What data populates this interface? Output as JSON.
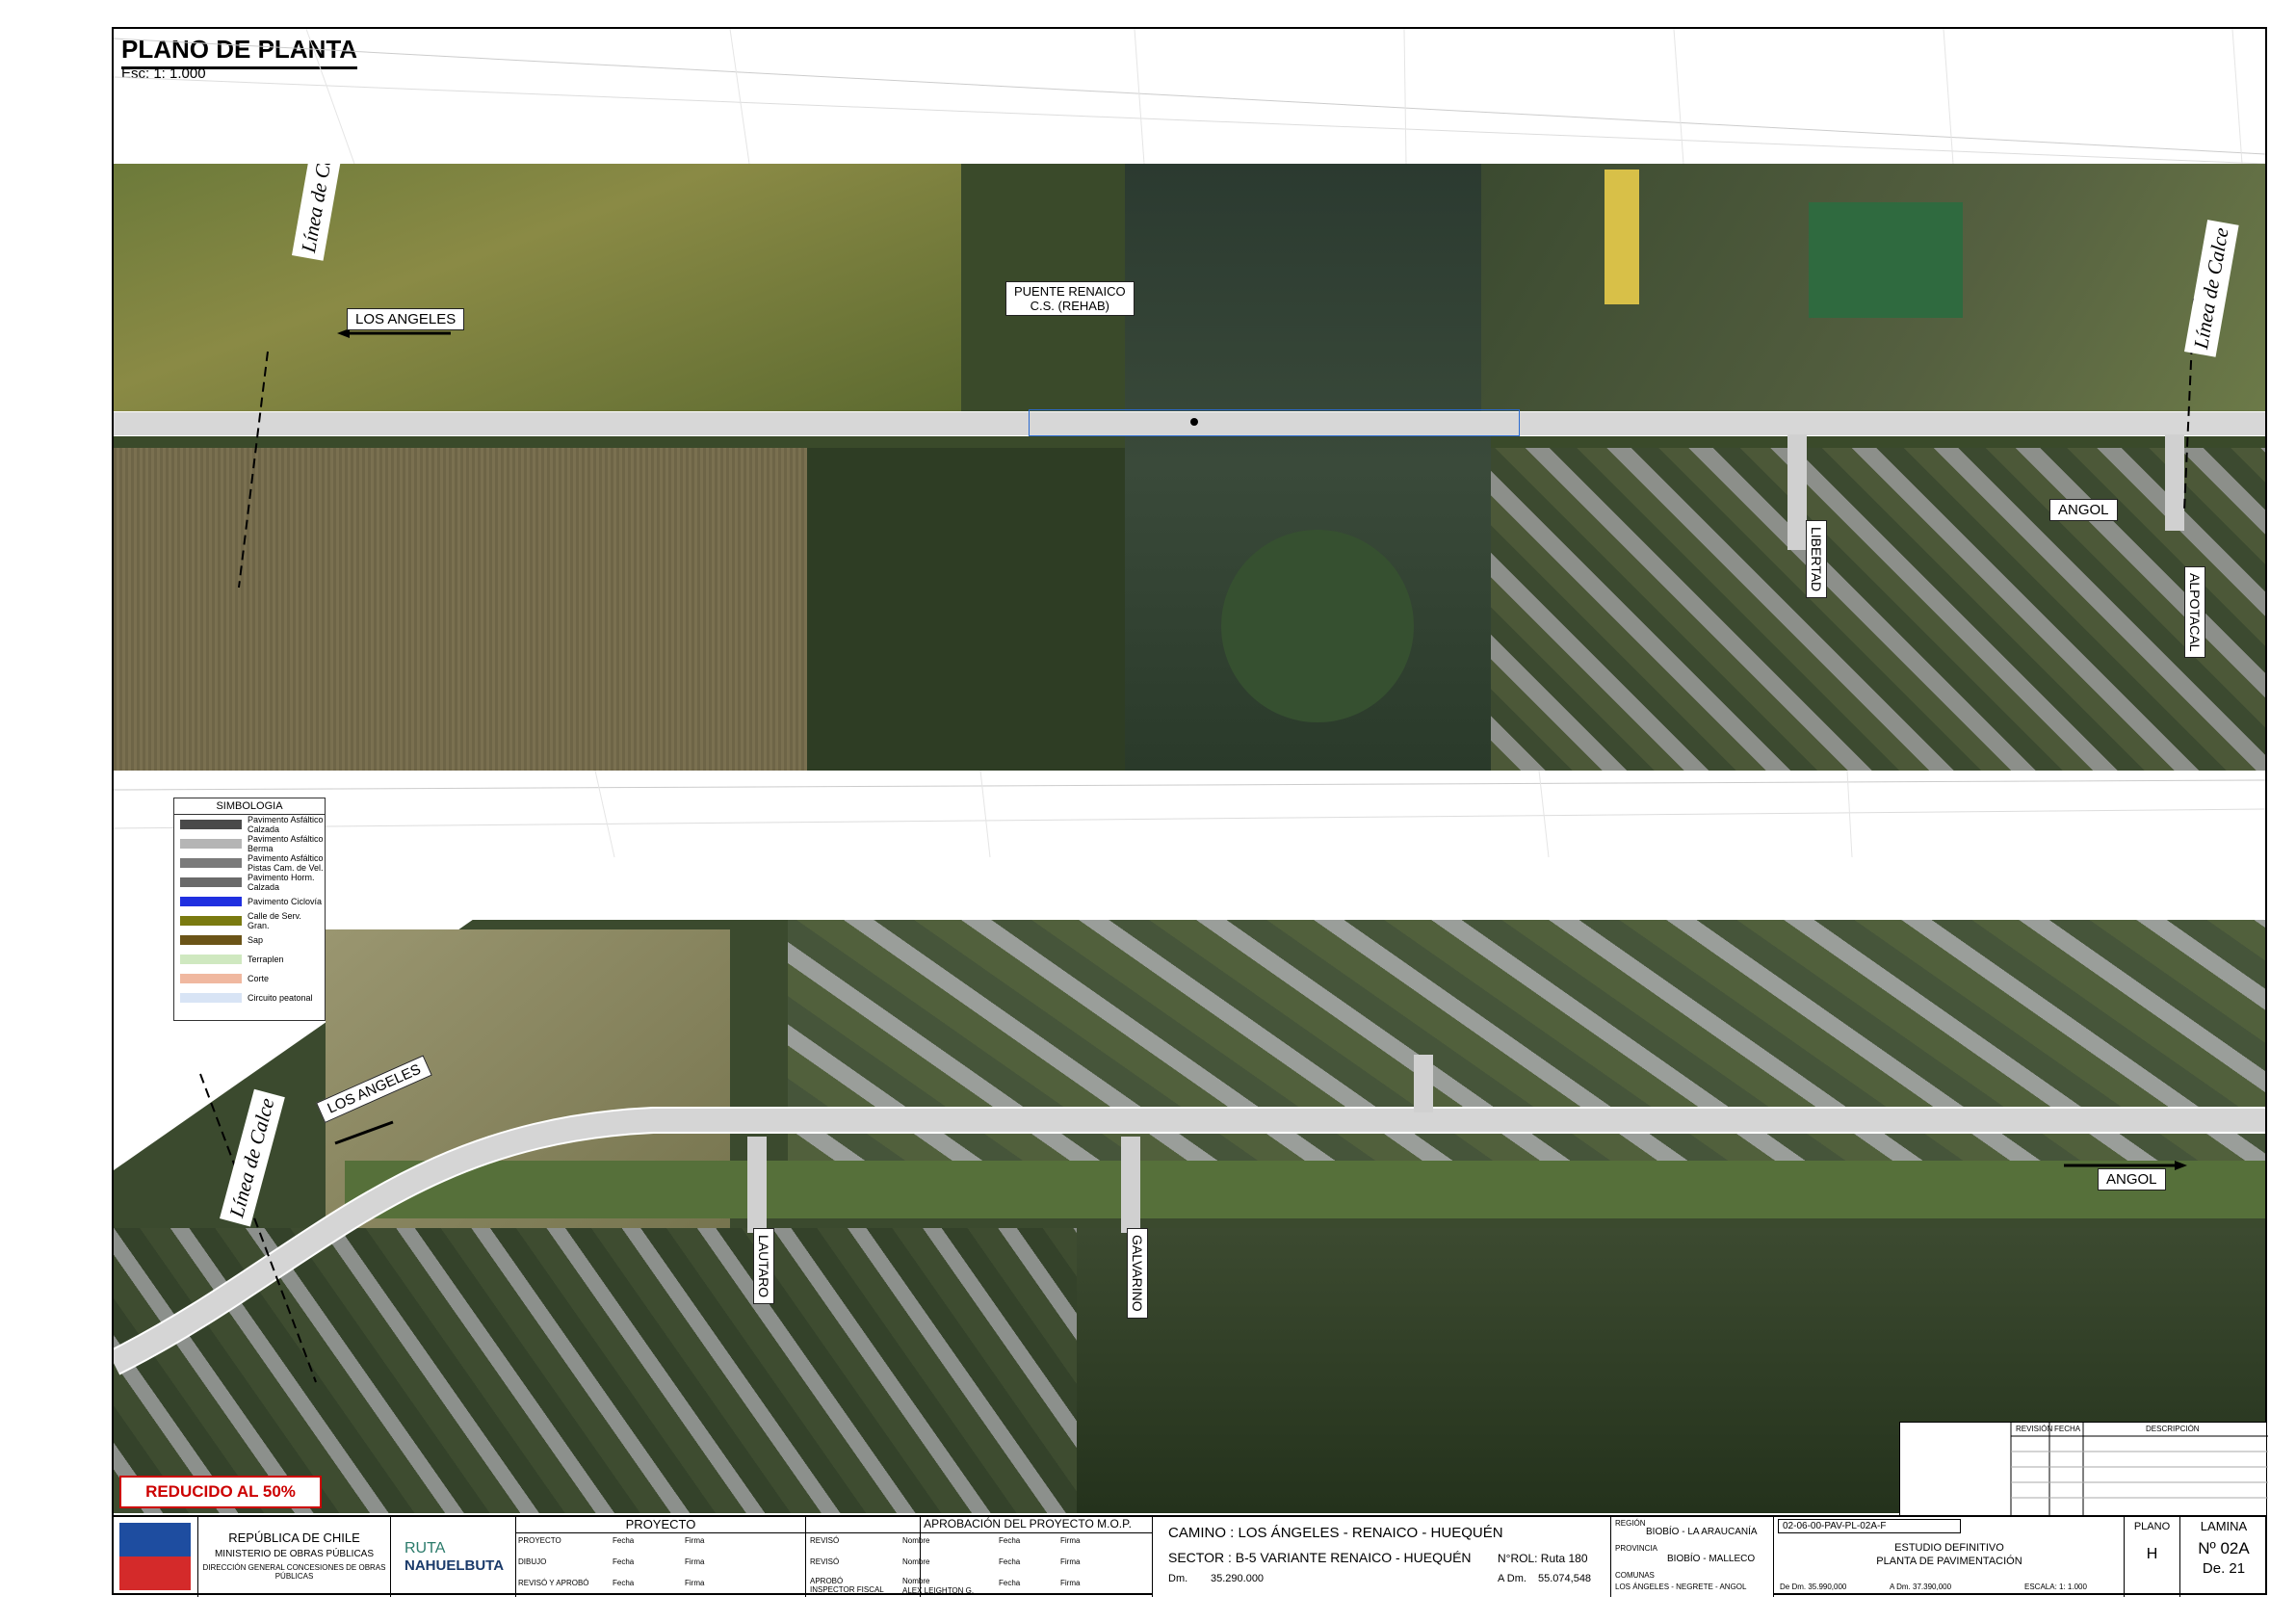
{
  "header": {
    "title": "PLANO DE PLANTA",
    "scale": "Esc: 1: 1.000"
  },
  "top_map": {
    "labels": {
      "los_angeles": "LOS ANGELES",
      "puente_line1": "PUENTE RENAICO",
      "puente_line2": "C.S. (REHAB)",
      "angol": "ANGOL",
      "libertad": "LIBERTAD",
      "alpotacal": "ALPOTACAL",
      "calce": "Línea de Calce"
    }
  },
  "bottom_map": {
    "labels": {
      "los_angeles": "LOS ANGELES",
      "angol": "ANGOL",
      "lautaro": "LAUTARO",
      "galvarino": "GALVARINO",
      "calce": "Línea de Calce"
    }
  },
  "legend": {
    "title": "SIMBOLOGIA",
    "items": [
      {
        "label": "Pavimento Asfáltico Calzada",
        "color": "#4a4a4a"
      },
      {
        "label": "Pavimento Asfáltico Berma",
        "color": "#b5b5b5"
      },
      {
        "label": "Pavimento Asfáltico Pistas Cam. de Vel.",
        "color": "#7a7a7a"
      },
      {
        "label": "Pavimento Horm. Calzada",
        "color": "#6a6a6a"
      },
      {
        "label": "Pavimento Ciclovía",
        "color": "#1f2fe0"
      },
      {
        "label": "Calle de Serv. Gran.",
        "color": "#7a7a10"
      },
      {
        "label": "Sap",
        "color": "#6b5418"
      },
      {
        "label": "Terraplen",
        "color": "#cfe8c0"
      },
      {
        "label": "Corte",
        "color": "#f0b8a0"
      },
      {
        "label": "Circuito peatonal",
        "color": "#d8e4f5"
      }
    ]
  },
  "stamp": "REDUCIDO AL 50%",
  "revision_table": {
    "col1": "REVISIÓN",
    "col2": "FECHA",
    "col3": "DESCRIPCIÓN"
  },
  "title_block": {
    "country": "REPÚBLICA DE CHILE",
    "ministry": "MINISTERIO DE OBRAS PÚBLICAS",
    "direction": "DIRECCIÓN GENERAL CONCESIONES DE OBRAS PÚBLICAS",
    "logo_ruta": "RUTA",
    "logo_name": "NAHUELBUTA",
    "proyecto_title": "PROYECTO",
    "aprobacion_title": "APROBACIÓN DEL PROYECTO M.O.P.",
    "proyecto_rows": [
      "PROYECTO",
      "DIBUJO",
      "REVISÓ Y APROBÓ"
    ],
    "aprobacion_rows": [
      "REVISÓ",
      "REVISÓ",
      "APROBÓ INSPECTOR FISCAL"
    ],
    "fecha": "Fecha",
    "firma": "Firma",
    "nombre": "Nombre",
    "inspector_name": "ALEX LEIGHTON G.",
    "camino": "CAMINO : LOS ÁNGELES - RENAICO - HUEQUÉN",
    "sector": "SECTOR : B-5 VARIANTE RENAICO - HUEQUÉN",
    "rol": "N°ROL: Ruta 180",
    "dm_label": "Dm.",
    "dm_value": "35.290.000",
    "adm_label": "A Dm.",
    "adm_value": "55.074,548",
    "region_label": "REGIÓN",
    "region_value": "BIOBÍO - LA ARAUCANÍA",
    "provincia_label": "PROVINCIA",
    "provincia_value": "BIOBÍO - MALLECO",
    "comunas_label": "COMUNAS",
    "comunas_value": "LOS ÁNGELES - NEGRETE - ANGOL",
    "code": "02-06-00-PAV-PL-02A-F",
    "estudio1": "ESTUDIO DEFINITIVO",
    "estudio2": "PLANTA DE PAVIMENTACIÓN",
    "de_dm": "De Dm. 35.990,000",
    "a_dm": "A Dm. 37.390,000",
    "escala": "ESCALA: 1: 1.000",
    "plano_label": "PLANO",
    "plano_value": "H",
    "lamina_label": "LAMINA",
    "lamina_value": "Nº 02A",
    "lamina_of": "De. 21"
  }
}
